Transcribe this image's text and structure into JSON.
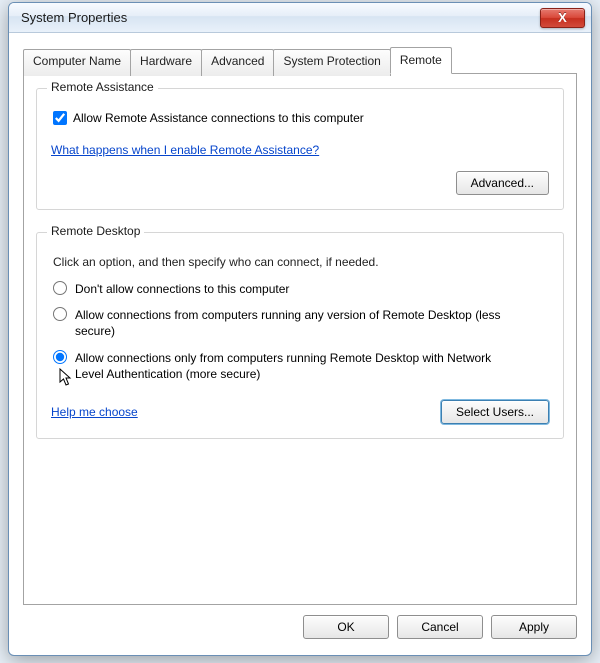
{
  "window": {
    "title": "System Properties",
    "close_glyph": "X"
  },
  "tabs": {
    "t0": "Computer Name",
    "t1": "Hardware",
    "t2": "Advanced",
    "t3": "System Protection",
    "t4": "Remote"
  },
  "ra": {
    "group_title": "Remote Assistance",
    "checkbox_label": "Allow Remote Assistance connections to this computer",
    "checkbox_checked": true,
    "help_link": "What happens when I enable Remote Assistance?",
    "advanced_btn": "Advanced..."
  },
  "rd": {
    "group_title": "Remote Desktop",
    "desc": "Click an option, and then specify who can connect, if needed.",
    "opt1": "Don't allow connections to this computer",
    "opt2": "Allow connections from computers running any version of Remote Desktop (less secure)",
    "opt3": "Allow connections only from computers running Remote Desktop with Network Level Authentication (more secure)",
    "selected": 3,
    "help_link": "Help me choose",
    "select_users_btn": "Select Users..."
  },
  "footer": {
    "ok": "OK",
    "cancel": "Cancel",
    "apply": "Apply"
  }
}
